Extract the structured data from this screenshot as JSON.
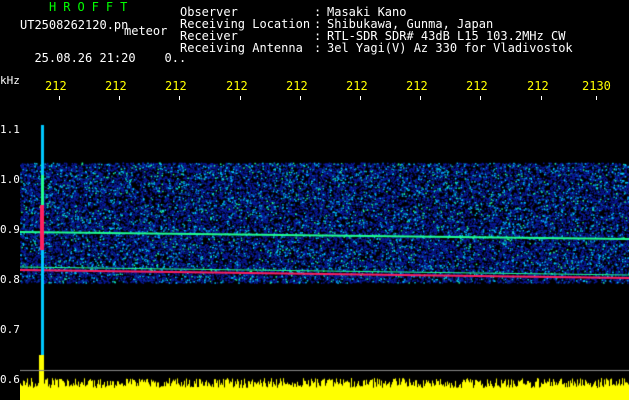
{
  "header": {
    "app_title": "HROFFT",
    "file_name": "UT2508262120.pn",
    "tag": "meteor",
    "datetime": "25.08.26 21:20",
    "counter": "0..",
    "rows": [
      {
        "label": "Observer",
        "value": "Masaki Kano"
      },
      {
        "label": "Receiving Location",
        "value": "Shibukawa, Gunma, Japan"
      },
      {
        "label": "Receiver",
        "value": "RTL-SDR SDR# 43dB L15 103.2MHz CW"
      },
      {
        "label": "Receiving Antenna",
        "value": "3el Yagi(V) Az 330 for Vladivostok"
      }
    ],
    "separator": ":"
  },
  "axes": {
    "y_unit": "kHz",
    "y_ticks": [
      "1.1",
      "1.0",
      "0.9",
      "0.8",
      "0.7",
      "0.6"
    ],
    "x_ticks": [
      "212",
      "212",
      "212",
      "212",
      "212",
      "212",
      "212",
      "212",
      "212",
      "2130"
    ]
  },
  "colors": {
    "background": "#000000",
    "title": "#00ff00",
    "tick": "#ffff00",
    "text": "#ffffff",
    "spectrum_low": "#0a1a9c",
    "spectrum_mid": "#00c8ff",
    "spectrum_line": "#20ff90",
    "spectrum_hot": "#ff2060",
    "power_bar": "#ffff00"
  },
  "spectrogram": {
    "noise_band_khz": [
      0.795,
      1.035
    ],
    "traces_khz": [
      0.89,
      0.82,
      0.81
    ],
    "meteor_x_frac": 0.035
  }
}
